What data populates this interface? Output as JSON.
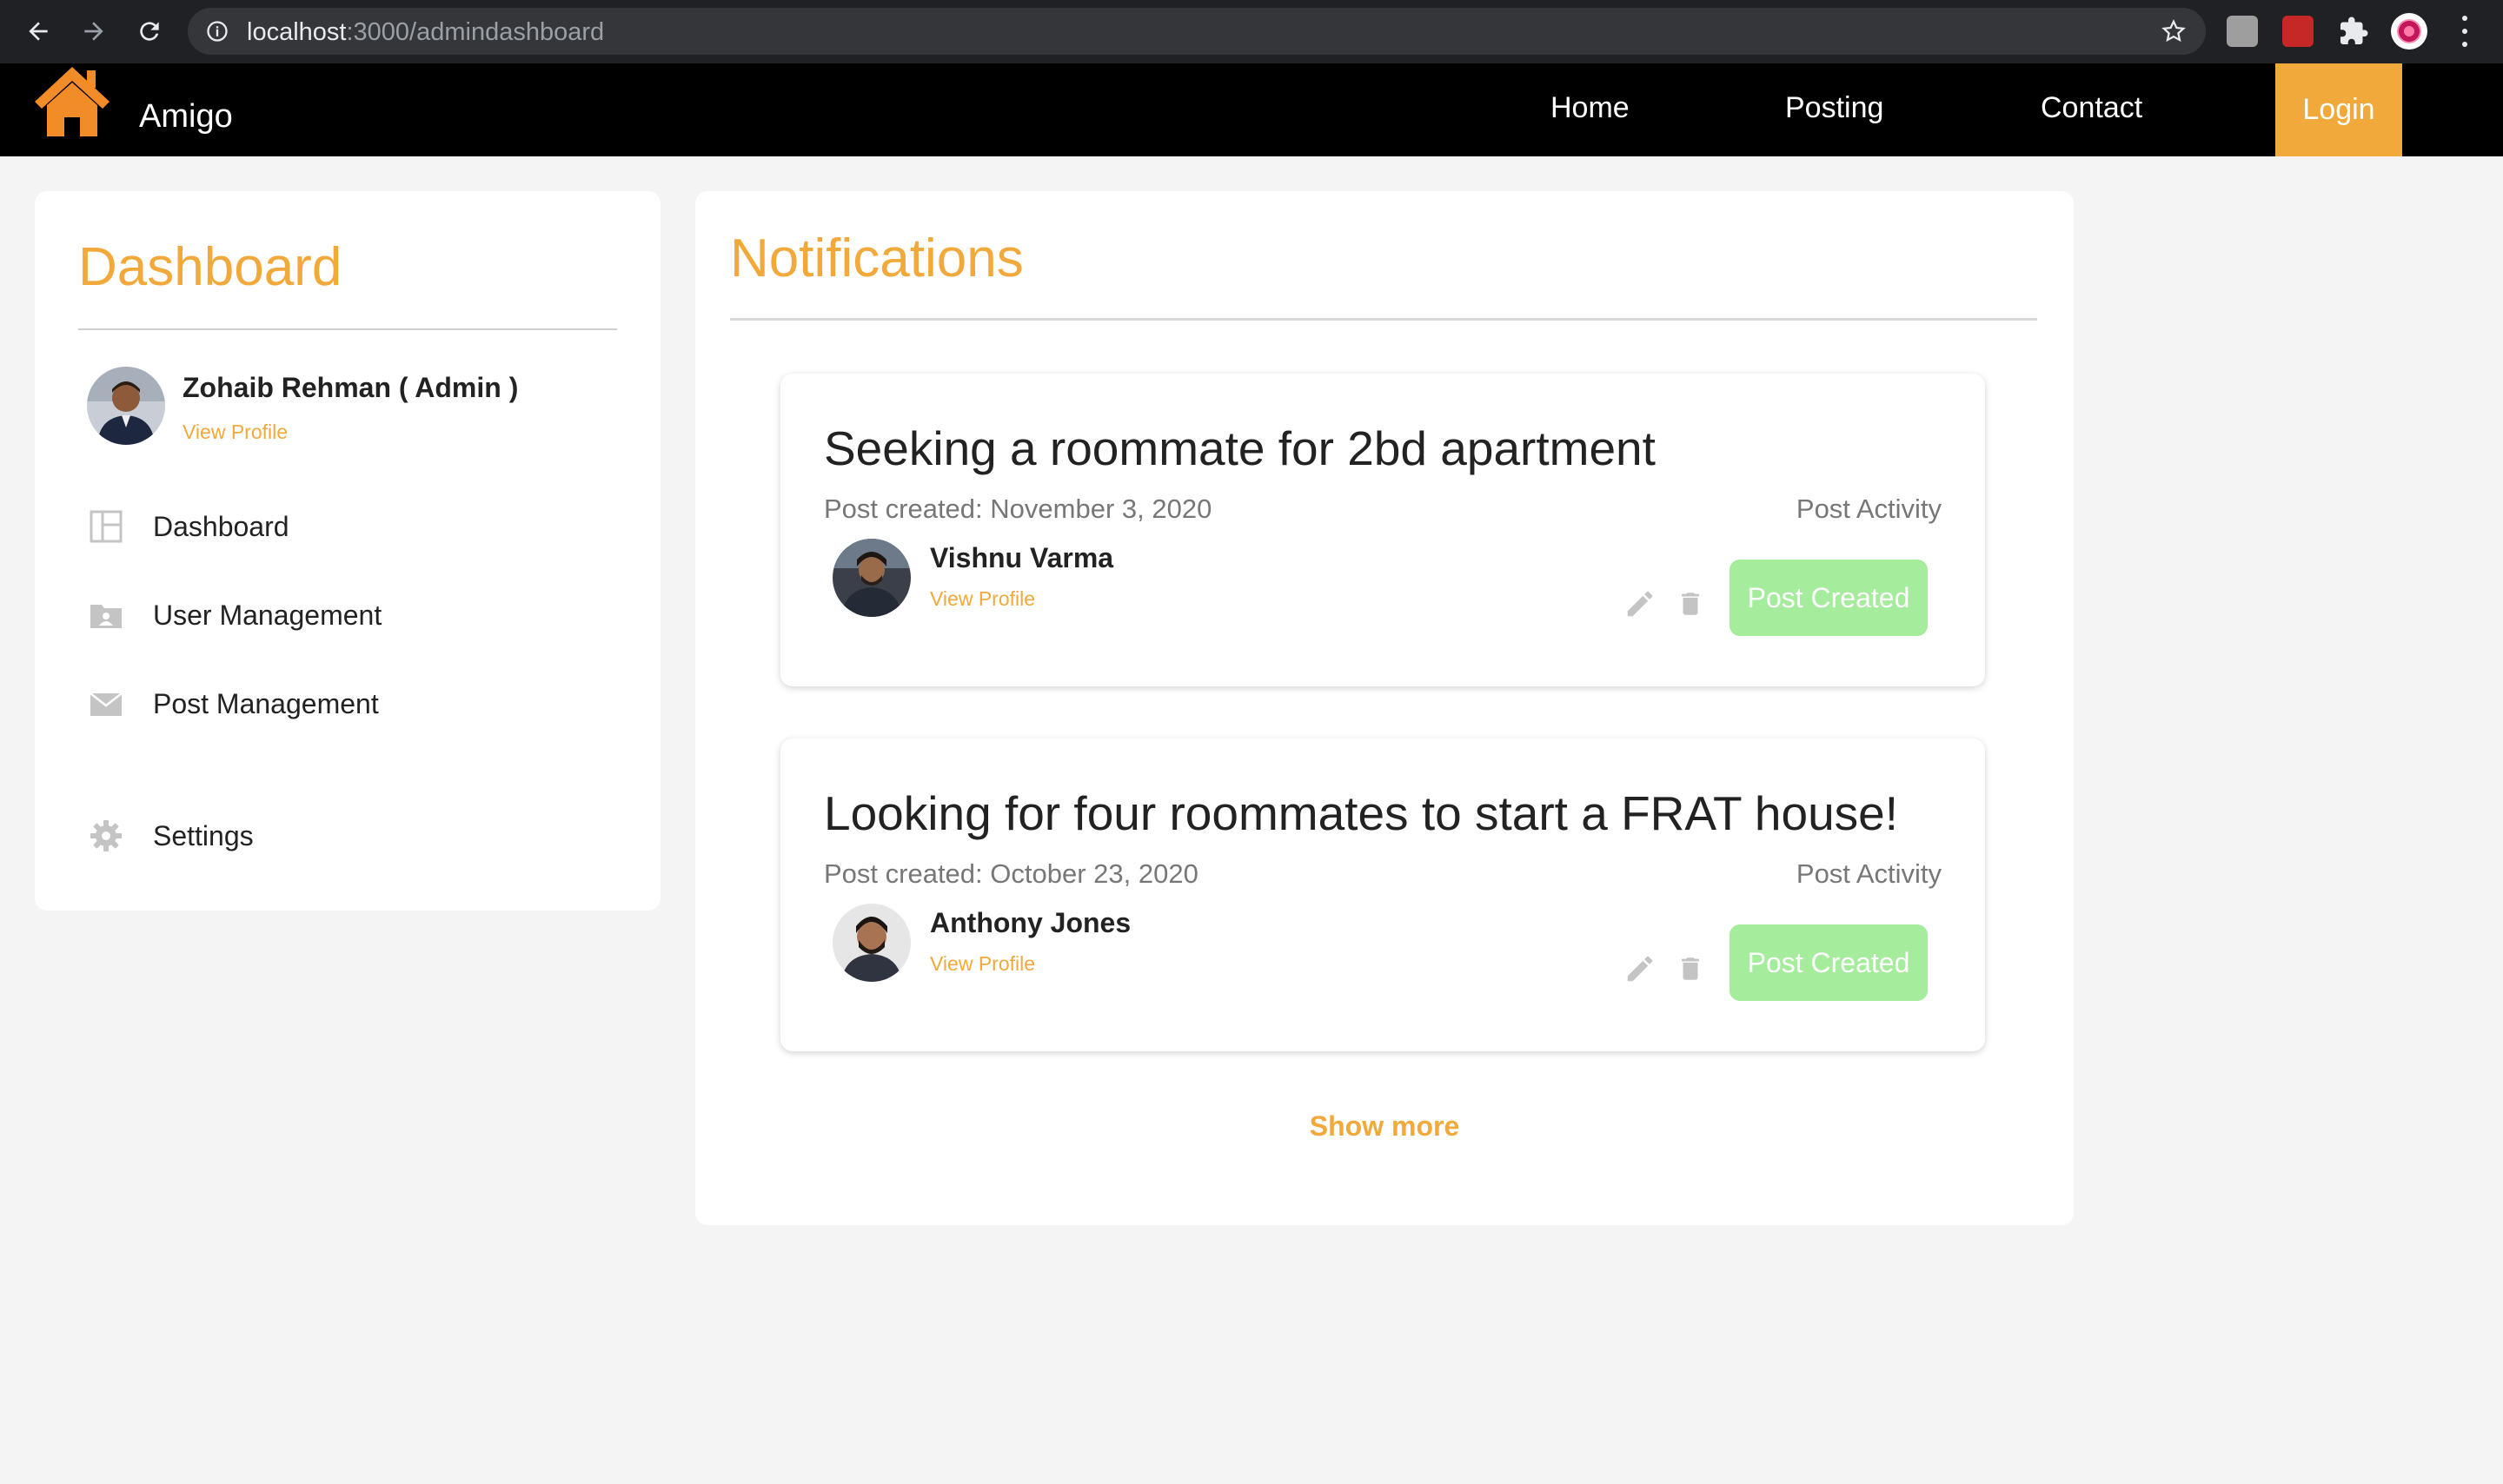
{
  "browser": {
    "url_host": "localhost",
    "url_path": ":3000/admindashboard"
  },
  "navbar": {
    "brand": "Amigo",
    "links": [
      "Home",
      "Posting",
      "Contact"
    ],
    "login": "Login"
  },
  "sidebar": {
    "title": "Dashboard",
    "admin_name": "Zohaib Rehman ( Admin )",
    "view_profile": "View Profile",
    "items": [
      {
        "label": "Dashboard",
        "icon": "dashboard-icon"
      },
      {
        "label": "User Management",
        "icon": "user-folder-icon"
      },
      {
        "label": "Post Management",
        "icon": "envelope-icon"
      },
      {
        "label": "Settings",
        "icon": "gear-icon"
      }
    ]
  },
  "notifications": {
    "title": "Notifications",
    "show_more": "Show more",
    "cards": [
      {
        "title": "Seeking a roommate for 2bd apartment",
        "date": "Post created: November 3, 2020",
        "activity_label": "Post Activity",
        "user_name": "Vishnu Varma",
        "view_profile": "View Profile",
        "status": "Post Created"
      },
      {
        "title": "Looking for four roommates to start a FRAT house!",
        "date": "Post created: October 23, 2020",
        "activity_label": "Post Activity",
        "user_name": "Anthony Jones",
        "view_profile": "View Profile",
        "status": "Post Created"
      }
    ]
  },
  "colors": {
    "accent": "#f2a93b",
    "status_green": "#a6ec9d",
    "navbar_bg": "#000000",
    "page_bg": "#f4f4f4"
  }
}
